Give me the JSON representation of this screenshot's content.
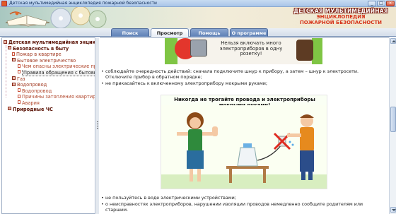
{
  "window": {
    "title": "Детская мультимедийная энциклопедия пожарной безопасности",
    "buttons": {
      "minimize": "_",
      "maximize": "□",
      "close": "×"
    }
  },
  "header": {
    "brand_line1": "ДЕТСКАЯ МУЛЬТИМЕДИЙНАЯ",
    "brand_line2": "ЭНЦИКЛОПЕДИЯ",
    "brand_line3": "ПОЖАРНОЙ БЕЗОПАСНОСТИ"
  },
  "nav": {
    "tabs": [
      {
        "label": "Поиск",
        "active": false
      },
      {
        "label": "Просмотр",
        "active": true
      },
      {
        "label": "Помощь",
        "active": false
      },
      {
        "label": "О программе",
        "active": false
      }
    ]
  },
  "tree": {
    "items": [
      {
        "label": "Детская мультимедийная энциклопе...",
        "level": 0,
        "icon": "book-icon"
      },
      {
        "label": "Безопасность в быту",
        "level": 1,
        "icon": "book-icon"
      },
      {
        "label": "Пожар в квартире",
        "level": 2,
        "icon": "page-icon"
      },
      {
        "label": "Бытовое электричество",
        "level": 2,
        "icon": "book-icon"
      },
      {
        "label": "Чем опасны электрические при",
        "level": 3,
        "icon": "page-icon"
      },
      {
        "label": "Правила обращения с бытовы...",
        "level": 3,
        "icon": "page-icon",
        "selected": true
      },
      {
        "label": "Газ",
        "level": 2,
        "icon": "book-icon"
      },
      {
        "label": "Водопровод",
        "level": 2,
        "icon": "book-icon"
      },
      {
        "label": "Водопровод",
        "level": 3,
        "icon": "page-icon"
      },
      {
        "label": "Причины затопления квартиры",
        "level": 3,
        "icon": "page-icon"
      },
      {
        "label": "Авария",
        "level": 3,
        "icon": "page-icon"
      },
      {
        "label": "Природные ЧС",
        "level": 1,
        "icon": "book-icon"
      }
    ]
  },
  "content": {
    "image1_caption": "Нельзя включать много электроприборов в одну розетку!",
    "bullets_top": [
      "соблюдайте очередность действий: сначала подключите шнур к прибору, а затем – шнур к электросети. Отключите прибор в обратном порядке;",
      "не прикасайтесь к включенному электроприбору мокрыми руками;"
    ],
    "image2_caption": "Никогда не трогайте провода и электроприборы мокрыми руками!",
    "bullets_bottom": [
      "не пользуйтесь в воде электрическими устройствами;",
      "о неисправностях электроприборов, нарушении изоляции проводов немедленно сообщите родителям или старшим."
    ]
  },
  "colors": {
    "tab_active_bg": "#ffffff",
    "tab_bg": "#6d8cbf",
    "tree_text": "#a23a22",
    "brand_red": "#d6341a"
  }
}
